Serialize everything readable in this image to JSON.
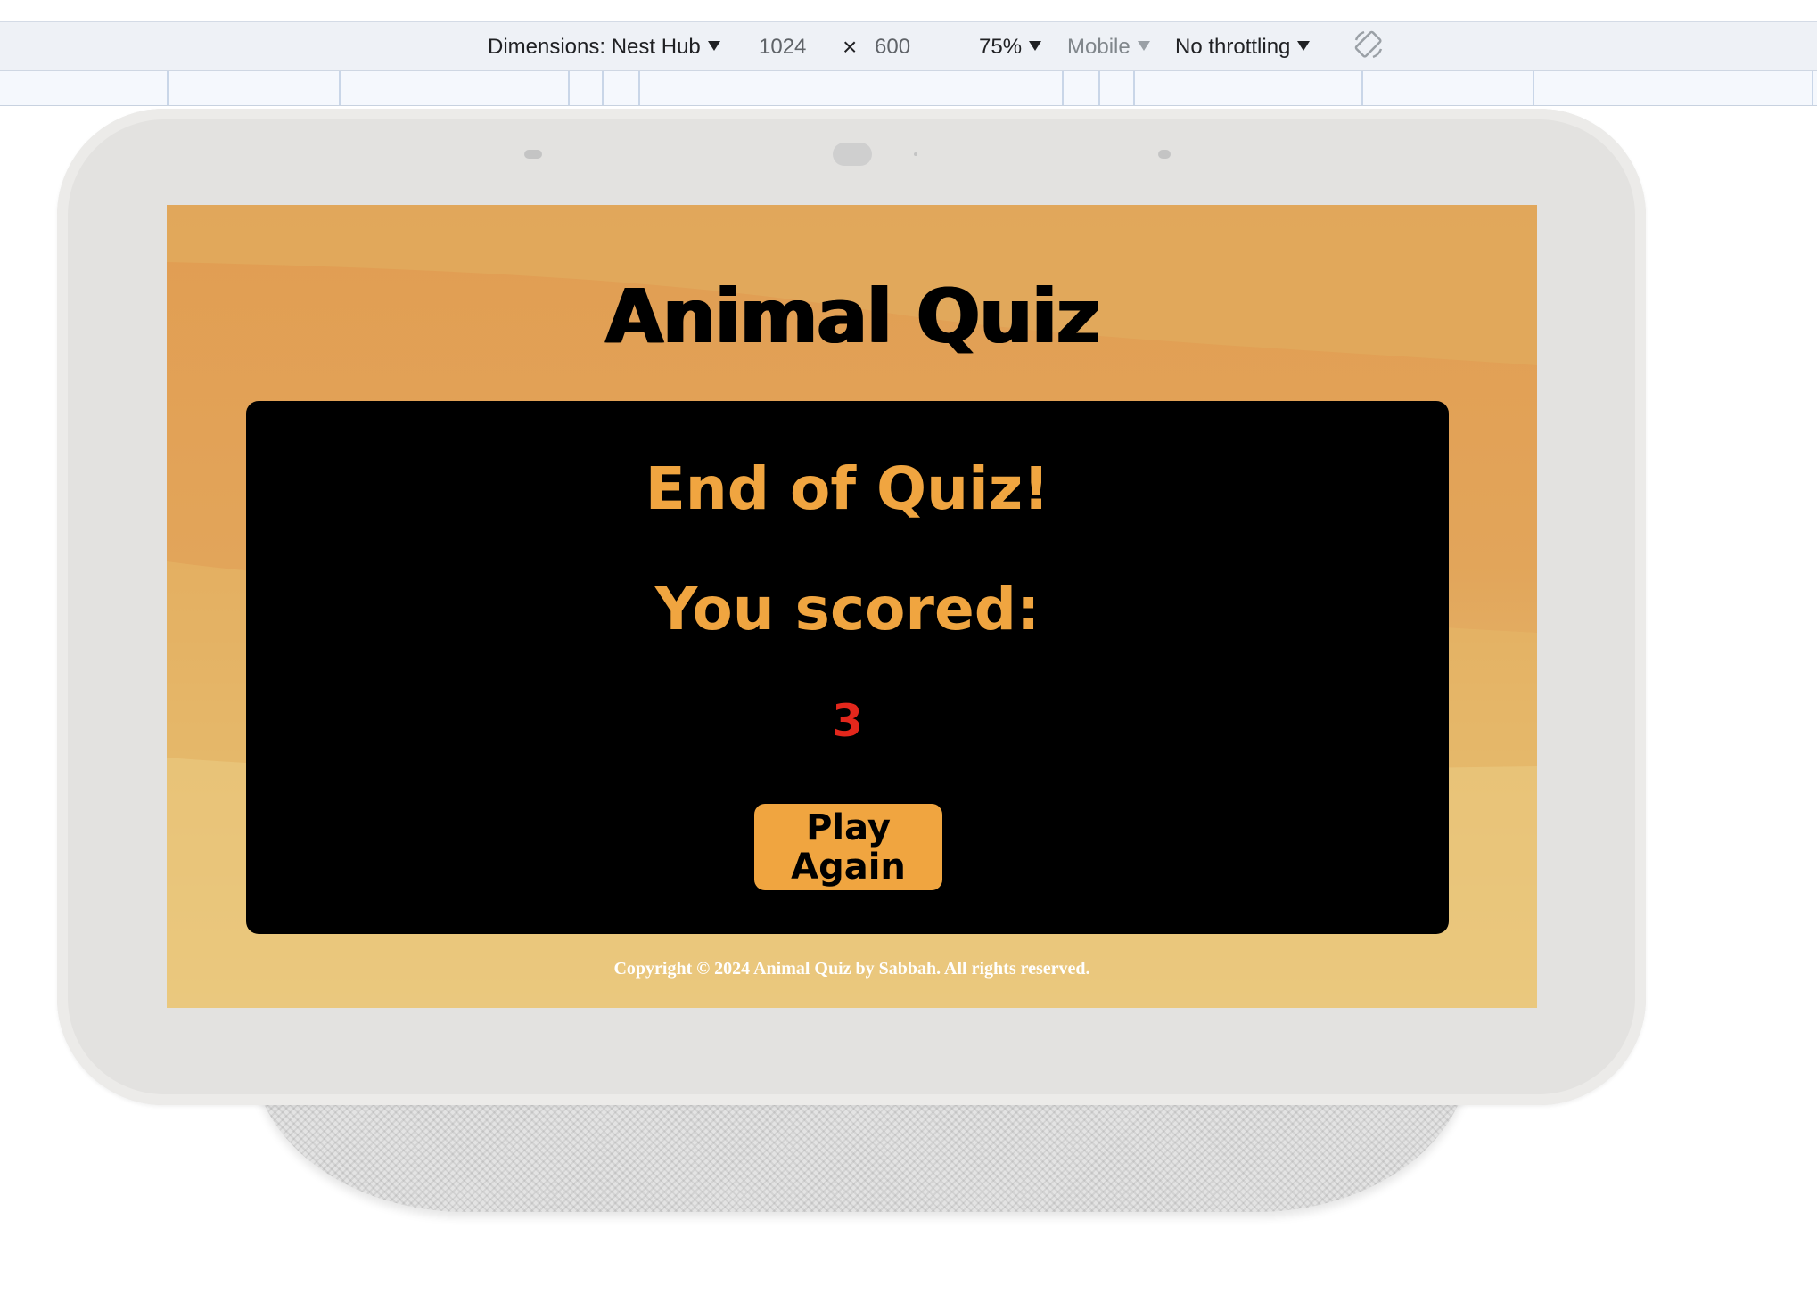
{
  "devtools": {
    "dimensions_label": "Dimensions: Nest Hub",
    "width_value": "1024",
    "times_symbol": "×",
    "height_value": "600",
    "zoom_label": "75%",
    "device_type_label": "Mobile",
    "throttling_label": "No throttling",
    "rotate_icon": "rotate-icon"
  },
  "app": {
    "title": "Animal Quiz",
    "end_heading": "End of Quiz!",
    "score_label": "You scored:",
    "score_value": "3",
    "play_again_label": "Play Again",
    "footer": "Copyright © 2024 Animal Quiz by Sabbah. All rights reserved."
  },
  "colors": {
    "accent": "#f0a540",
    "score": "#e3271c",
    "card": "#000000",
    "background_top": "#e19d52",
    "background_bottom": "#ecd088"
  }
}
